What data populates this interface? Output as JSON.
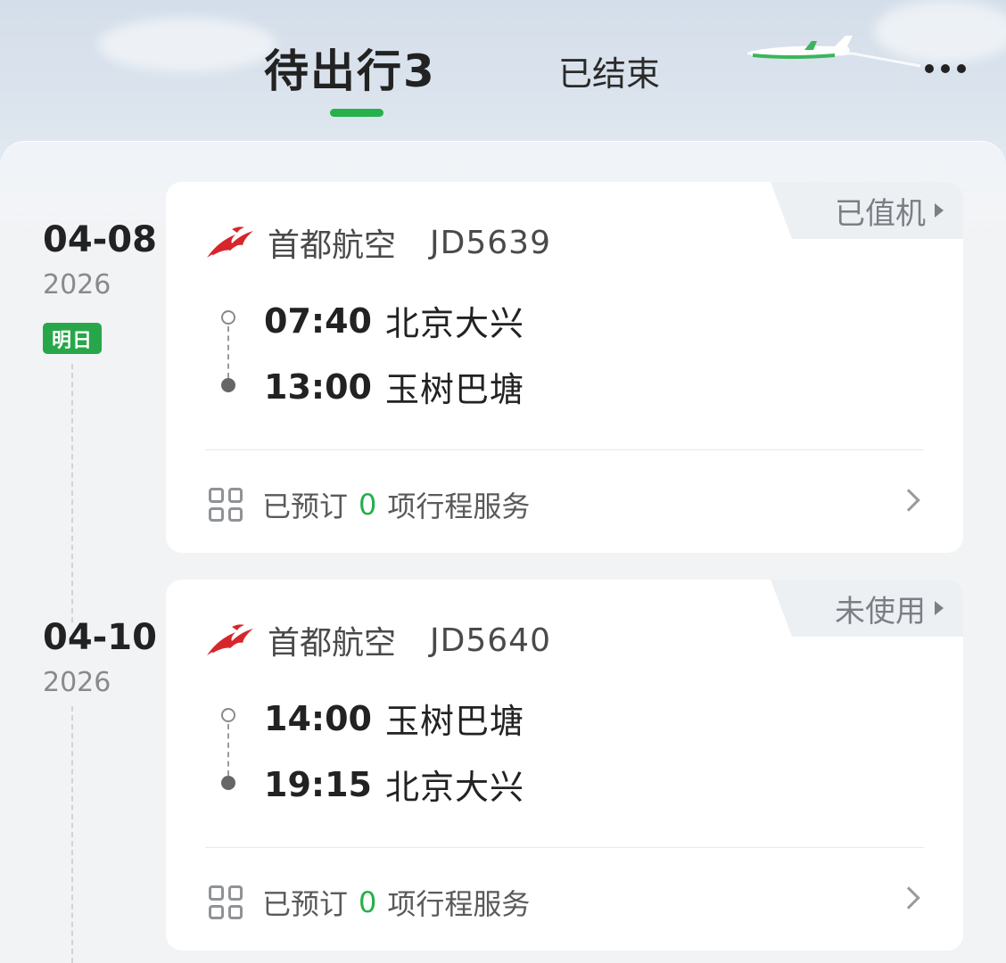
{
  "header": {
    "tab_pending_label": "待出行",
    "tab_pending_count": "3",
    "tab_finished_label": "已结束",
    "accent_color": "#27b04b"
  },
  "trips": [
    {
      "date": "04-08",
      "year": "2026",
      "day_badge": "明日",
      "status": "已值机",
      "airline": "首都航空",
      "flight_no": "JD5639",
      "depart_time": "07:40",
      "depart_city": "北京大兴",
      "arrive_time": "13:00",
      "arrive_city": "玉树巴塘",
      "service_prefix": "已预订",
      "service_count": "0",
      "service_suffix": "项行程服务"
    },
    {
      "date": "04-10",
      "year": "2026",
      "status": "未使用",
      "airline": "首都航空",
      "flight_no": "JD5640",
      "depart_time": "14:00",
      "depart_city": "玉树巴塘",
      "arrive_time": "19:15",
      "arrive_city": "北京大兴",
      "service_prefix": "已预订",
      "service_count": "0",
      "service_suffix": "项行程服务"
    }
  ],
  "icons": {
    "airline_logo": "capital-airlines-logo-icon",
    "more": "more-dots-icon",
    "services": "grid-icon",
    "chevron": "chevron-right-icon"
  }
}
